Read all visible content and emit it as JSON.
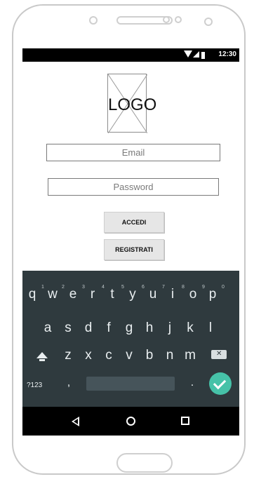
{
  "status_bar": {
    "time": "12:30"
  },
  "login": {
    "logo_text": "LOGO",
    "email_placeholder": "Email",
    "password_placeholder": "Password",
    "login_button": "ACCEDI",
    "register_button": "REGISTRATI"
  },
  "keyboard": {
    "row1": [
      "q",
      "w",
      "e",
      "r",
      "t",
      "y",
      "u",
      "i",
      "o",
      "p"
    ],
    "row1_numbers": [
      "1",
      "2",
      "3",
      "4",
      "5",
      "6",
      "7",
      "8",
      "9",
      "0"
    ],
    "row2": [
      "a",
      "s",
      "d",
      "f",
      "g",
      "h",
      "j",
      "k",
      "l"
    ],
    "row3": [
      "z",
      "x",
      "c",
      "v",
      "b",
      "n",
      "m"
    ],
    "symbols_key": "?123",
    "comma_key": ",",
    "period_key": ".",
    "icons": [
      "shift-icon",
      "backspace-icon",
      "enter-check-icon"
    ]
  },
  "nav_bar": {
    "icons": [
      "back-icon",
      "home-icon",
      "recent-apps-icon"
    ]
  }
}
